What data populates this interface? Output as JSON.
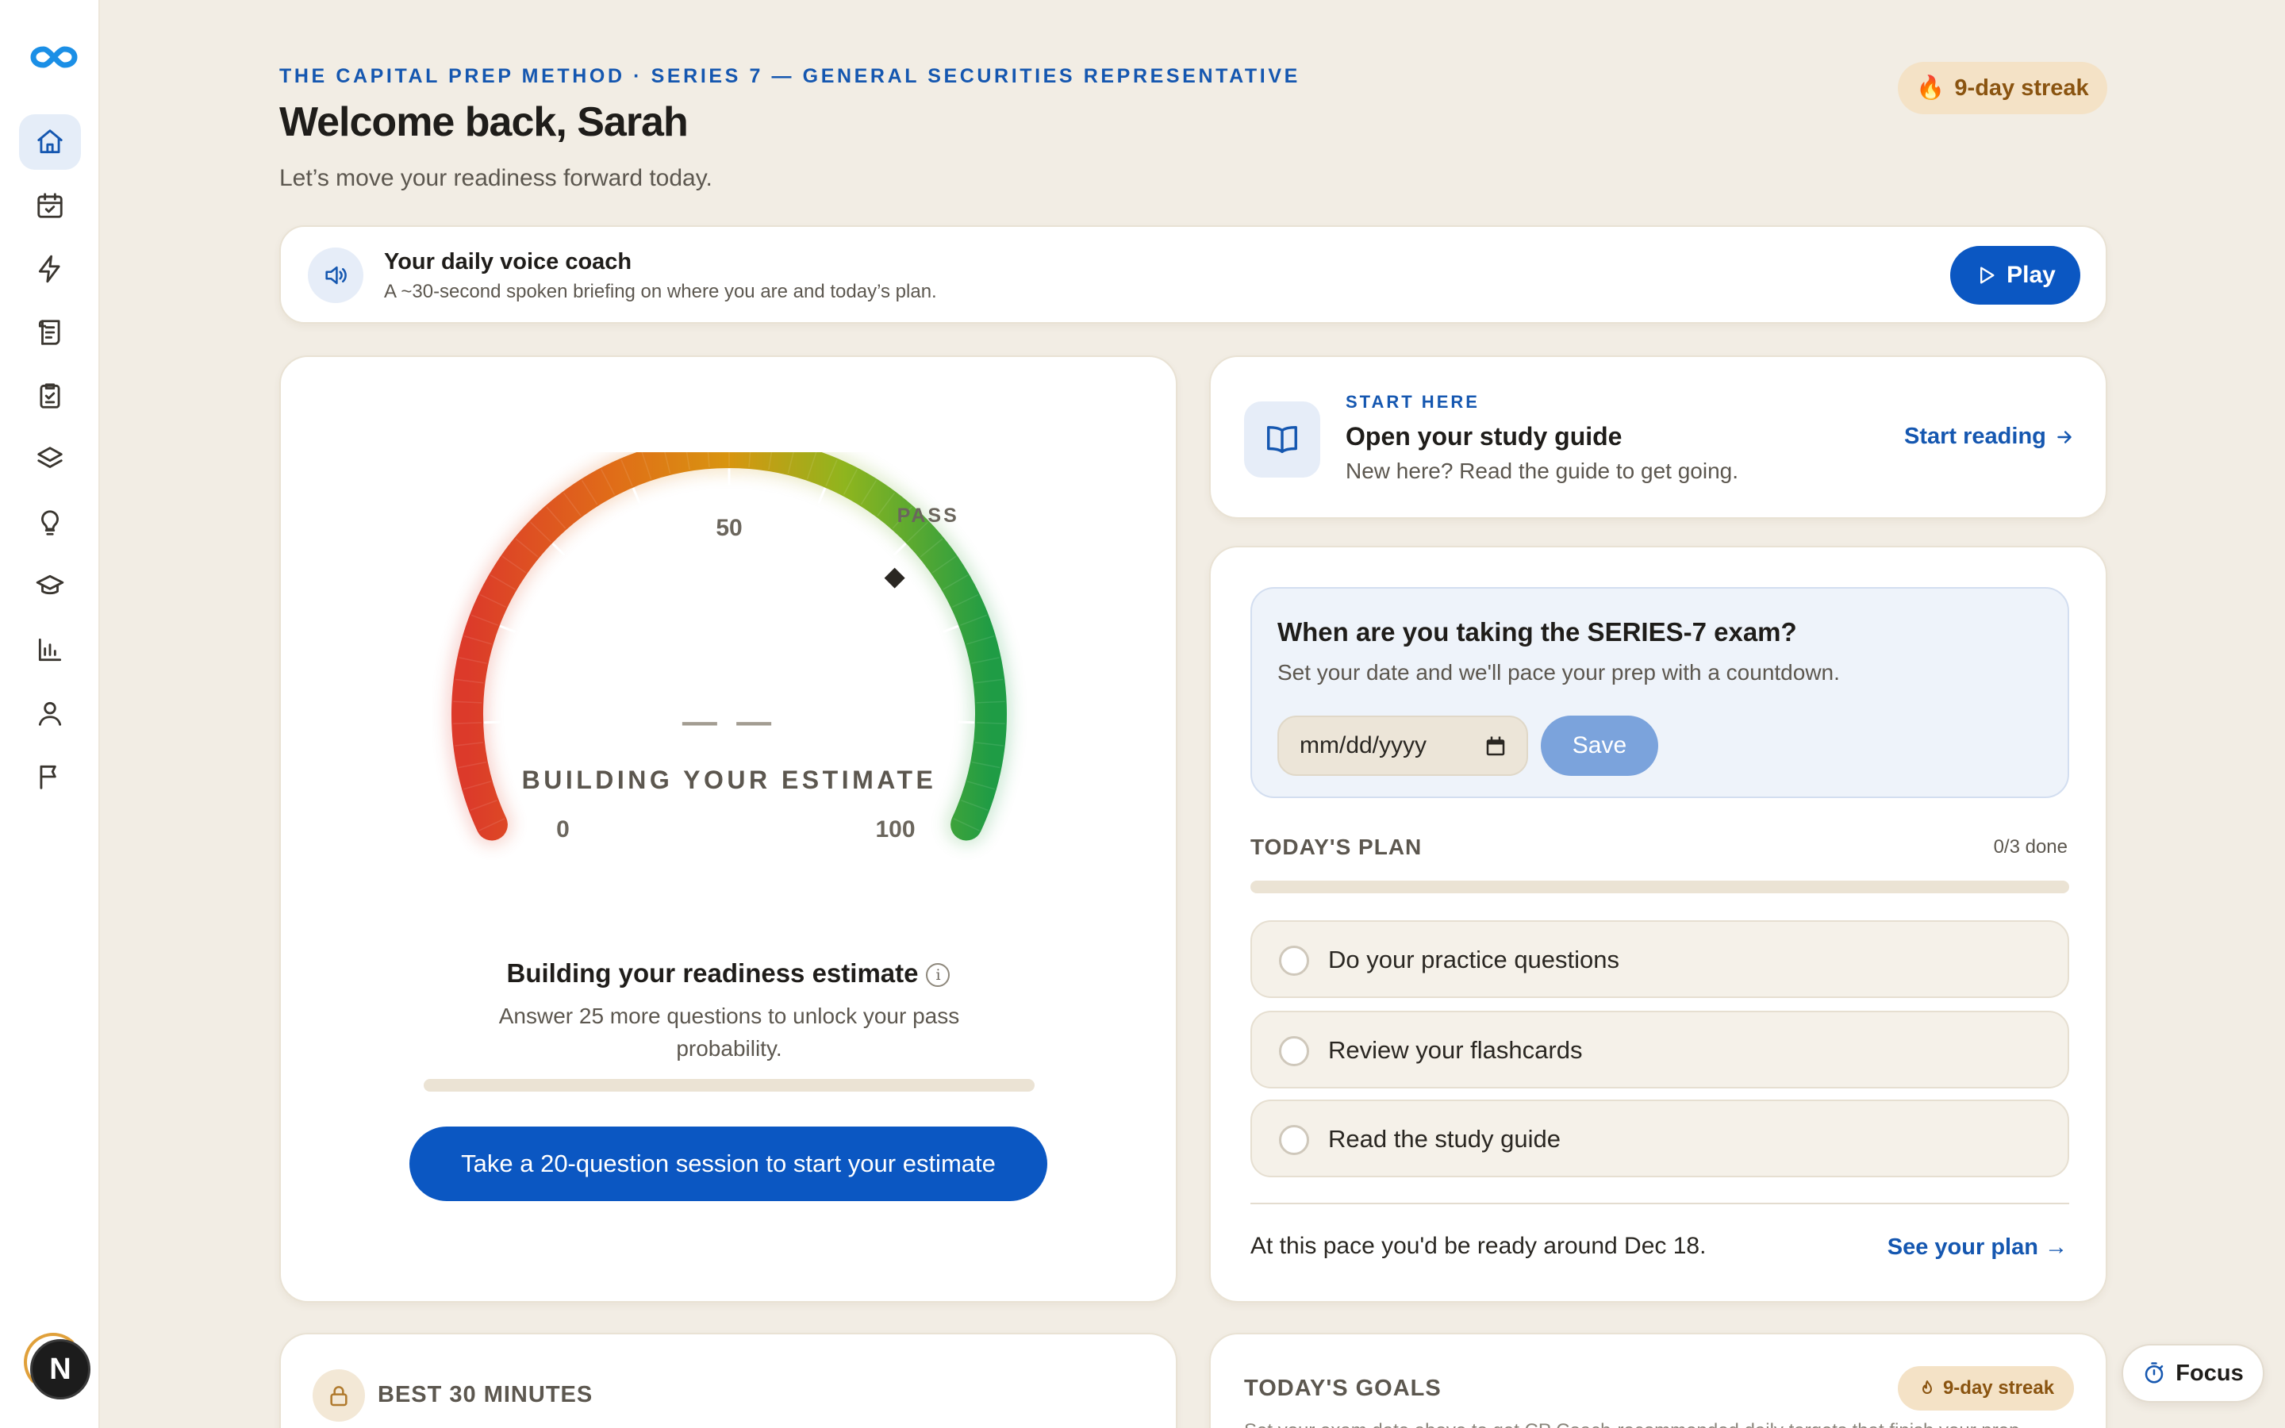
{
  "sidebar": {
    "logo": "infinity-logo",
    "items": [
      {
        "icon": "home-icon",
        "active": true
      },
      {
        "icon": "calendar-check-icon",
        "active": false
      },
      {
        "icon": "lightning-icon",
        "active": false
      },
      {
        "icon": "scroll-icon",
        "active": false
      },
      {
        "icon": "clipboard-check-icon",
        "active": false
      },
      {
        "icon": "layers-icon",
        "active": false
      },
      {
        "icon": "lightbulb-icon",
        "active": false
      },
      {
        "icon": "graduation-cap-icon",
        "active": false
      },
      {
        "icon": "bar-chart-icon",
        "active": false
      },
      {
        "icon": "user-icon",
        "active": false
      },
      {
        "icon": "flag-icon",
        "active": false
      }
    ],
    "avatar_initial": "N"
  },
  "header": {
    "eyebrow": "THE CAPITAL PREP METHOD · SERIES 7 — GENERAL SECURITIES REPRESENTATIVE",
    "welcome": "Welcome back, Sarah",
    "subtitle": "Let’s move your readiness forward today.",
    "streak": "9-day streak",
    "streak_icon": "🔥"
  },
  "voice_coach": {
    "title": "Your daily voice coach",
    "subtitle": "A ~30-second spoken briefing on where you are and today’s plan.",
    "play_label": "Play"
  },
  "readiness": {
    "gauge_mark_50": "50",
    "gauge_pass_label": "PASS",
    "gauge_value": "— —",
    "gauge_status": "BUILDING YOUR ESTIMATE",
    "gauge_min": "0",
    "gauge_max": "100",
    "pass_threshold": 72,
    "title": "Building your readiness estimate",
    "info_icon": "i",
    "description": "Answer 25 more questions to unlock your pass probability.",
    "progress": 0,
    "cta_label": "Take a 20-question session to start your estimate"
  },
  "study_guide": {
    "eyebrow": "START HERE",
    "title": "Open your study guide",
    "subtitle": "New here? Read the guide to get going.",
    "link_label": "Start reading"
  },
  "exam_date": {
    "title": "When are you taking the SERIES-7 exam?",
    "subtitle": "Set your date and we'll pace your prep with a countdown.",
    "date_placeholder": "mm/dd/yyyy",
    "save_label": "Save"
  },
  "todays_plan": {
    "label": "TODAY'S PLAN",
    "count": "0/3 done",
    "progress": 0,
    "tasks": [
      {
        "label": "Do your practice questions",
        "done": false
      },
      {
        "label": "Review your flashcards",
        "done": false
      },
      {
        "label": "Read the study guide",
        "done": false
      }
    ],
    "pace_text": "At this pace you'd be ready around Dec 18.",
    "pace_link": "See your plan →"
  },
  "best_30": {
    "label": "BEST 30 MINUTES"
  },
  "todays_goals": {
    "label": "TODAY'S GOALS",
    "streak": "9-day streak",
    "text": "Set your exam date above to get CP Coach-recommended daily targets that finish your prep"
  },
  "focus": {
    "label": "Focus"
  },
  "colors": {
    "accent": "#0b57c2",
    "background": "#f2ede4",
    "streak_bg": "#f4e2c6",
    "gauge_start": "#dc3a2a",
    "gauge_mid": "#d88f0e",
    "gauge_end": "#1f9c45"
  }
}
